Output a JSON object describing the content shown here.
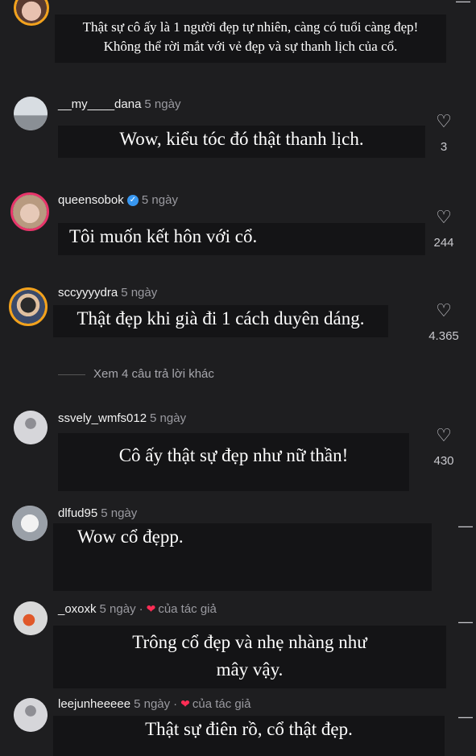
{
  "comments": [
    {
      "username": "",
      "time": "",
      "text_lines": [
        "Thật sự cô ấy là 1 người đẹp tự nhiên, càng có tuổi càng đẹp!",
        "Không thể rời mắt với vẻ đẹp và sự thanh lịch của cổ."
      ],
      "likes": ""
    },
    {
      "username": "__my____dana",
      "time": "5 ngày",
      "text_lines": [
        "Wow, kiểu tóc đó thật thanh lịch."
      ],
      "likes": "3"
    },
    {
      "username": "queensobok",
      "verified": true,
      "time": "5 ngày",
      "text_lines": [
        "Tôi muốn kết hôn với cổ."
      ],
      "likes": "244"
    },
    {
      "username": "sccyyyydra",
      "time": "5 ngày",
      "text_lines": [
        "Thật đẹp khi già đi 1 cách duyên dáng."
      ],
      "likes": "4.365"
    },
    {
      "username": "ssvely_wmfs012",
      "time": "5 ngày",
      "text_lines": [
        "Cô ấy thật sự đẹp như nữ thần!"
      ],
      "likes": "430"
    },
    {
      "username": "dlfud95",
      "time": "5 ngày",
      "text_lines": [
        "Wow cổ đẹpp."
      ],
      "likes": ""
    },
    {
      "username": "_oxoxk",
      "time": "5 ngày",
      "author_liked": "của tác giả",
      "text_lines": [
        "Trông cổ đẹp và nhẹ nhàng như",
        "mây vậy."
      ],
      "likes": ""
    },
    {
      "username": "leejunheeeee",
      "time": "5 ngày",
      "author_liked": "của tác giả",
      "text_lines": [
        "Thật sự điên rồ, cổ thật đẹp."
      ],
      "likes": ""
    }
  ],
  "view_more_replies": "Xem 4 câu trả lời khác",
  "icons": {
    "like": "heart-outline-icon",
    "verified": "verified-badge-icon",
    "author_like": "red-heart-icon",
    "collapse": "collapse-dash-icon"
  },
  "colors": {
    "background": "#1e1e20",
    "text_box": "#141416",
    "ring": "#f3a21c",
    "verified": "#3897f0",
    "author_heart": "#ff2d55"
  }
}
